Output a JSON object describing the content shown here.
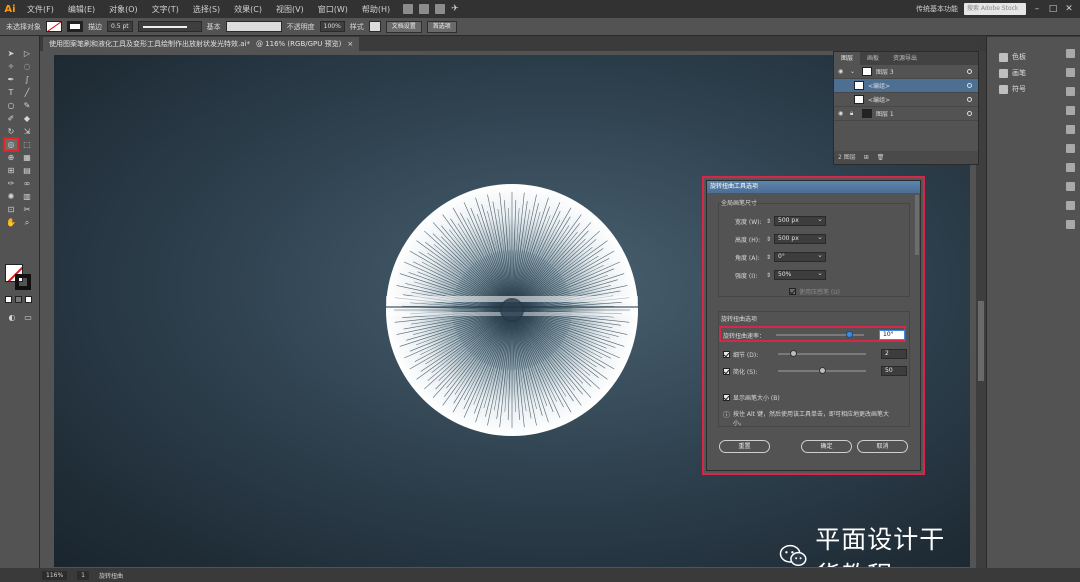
{
  "app": {
    "logo": "Ai",
    "menu": [
      "文件(F)",
      "编辑(E)",
      "对象(O)",
      "文字(T)",
      "选择(S)",
      "效果(C)",
      "视图(V)",
      "窗口(W)",
      "帮助(H)"
    ],
    "workspace": "传统基本功能",
    "search_placeholder": "搜索 Adobe Stock"
  },
  "controlbar": {
    "selection_label": "未选择对象",
    "stroke_label": "描边",
    "stroke_width": "0.5 pt",
    "stroke_style": "基本",
    "opacity_label": "不透明度",
    "opacity_value": "100%",
    "style_label": "样式",
    "doc_setup_button": "文档设置",
    "prefs_button": "首选项"
  },
  "document": {
    "tab_title": "使用图案笔刷和液化工具及变形工具绘制作出放射状发光特效.ai*",
    "tab_zoom": "@ 116% (RGB/GPU 预览)",
    "close_label": "×"
  },
  "layers_panel": {
    "tabs": [
      "图层",
      "画板",
      "资源导出"
    ],
    "active_tab": 0,
    "rows": [
      {
        "name": "图层 3",
        "indent": 0,
        "selected": false
      },
      {
        "name": "<编组>",
        "indent": 1,
        "selected": true
      },
      {
        "name": "<编组>",
        "indent": 1,
        "selected": false
      },
      {
        "name": "图层 1",
        "indent": 0,
        "selected": false
      }
    ],
    "footer": "2 图层"
  },
  "right_dock": {
    "items": [
      "色板",
      "画笔",
      "符号"
    ]
  },
  "dialog": {
    "title": "旋转扭曲工具选项",
    "global_section": "全局画笔尺寸",
    "width_label": "宽度 (W):",
    "width_value": "500 px",
    "height_label": "高度 (H):",
    "height_value": "500 px",
    "angle_label": "角度 (A):",
    "angle_value": "0°",
    "intensity_label": "强度 (I):",
    "intensity_value": "50%",
    "tablet_label": "使用压感笔 (U)",
    "twirl_section": "旋转扭曲选项",
    "twirl_rate_label": "旋转扭曲速率：",
    "twirl_rate_value": "10°",
    "twirl_rate_fraction": 0.86,
    "detail_label": "细节 (D):",
    "detail_value": "2",
    "detail_fraction": 0.15,
    "simplify_label": "简化 (S):",
    "simplify_value": "50",
    "simplify_fraction": 0.5,
    "show_brush_label": "显示画笔大小 (B)",
    "hint_text": "按住 Alt 键，然后使用该工具单击，即可相应地更改画笔大小。",
    "reset_button": "重置",
    "ok_button": "确定",
    "cancel_button": "取消"
  },
  "watermark": {
    "text": "平面设计干货教程"
  },
  "statusbar": {
    "zoom": "116%",
    "artboard": "1",
    "tool": "旋转扭曲"
  }
}
